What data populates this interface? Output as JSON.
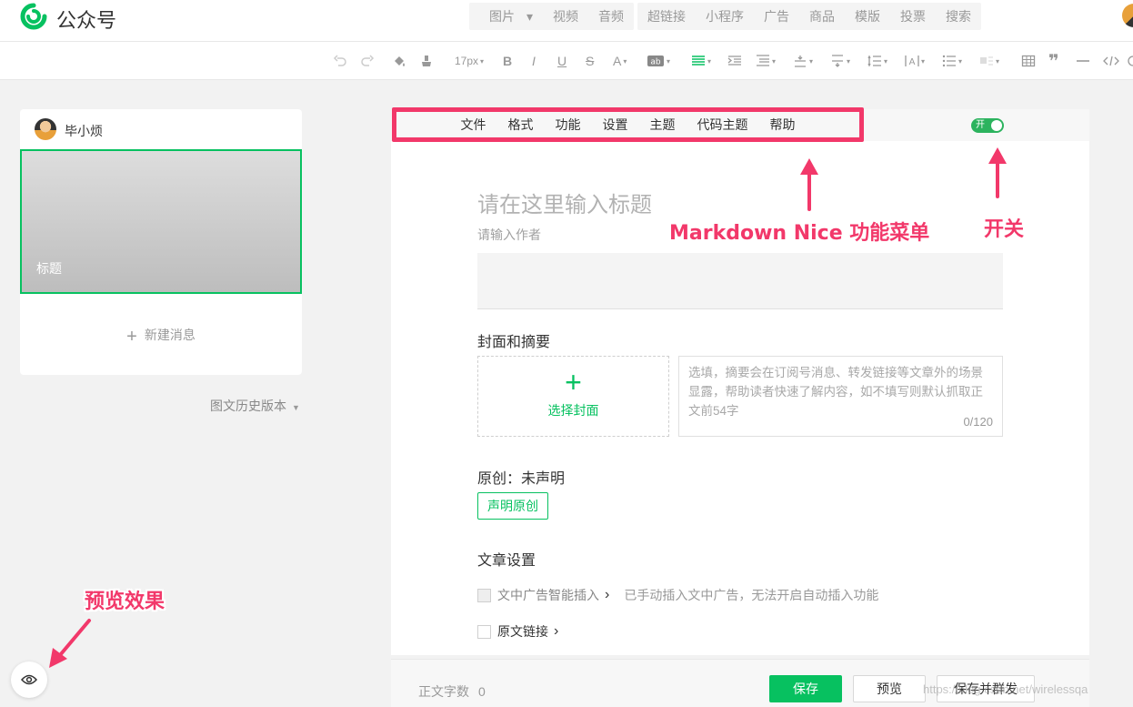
{
  "app": {
    "name": "公众号"
  },
  "topbar": {
    "insert_groups": [
      [
        "图片",
        "视频",
        "音频"
      ],
      [
        "超链接",
        "小程序",
        "广告",
        "商品",
        "模版",
        "投票",
        "搜索"
      ]
    ],
    "image_caret": "▾"
  },
  "toolbar": {
    "font_size": "17px"
  },
  "left": {
    "account_name": "毕小烦",
    "article_title": "标题",
    "new_message": "新建消息",
    "history": "图文历史版本"
  },
  "nice_menu": [
    "文件",
    "格式",
    "功能",
    "设置",
    "主题",
    "代码主题",
    "帮助"
  ],
  "toggle_label": "开",
  "editor": {
    "title_placeholder": "请在这里输入标题",
    "author_placeholder": "请输入作者",
    "cover_section": "封面和摘要",
    "cover_button": "选择封面",
    "summary_placeholder": "选填，摘要会在订阅号消息、转发链接等文章外的场景显露，帮助读者快速了解内容，如不填写则默认抓取正文前54字",
    "summary_count": "0/120",
    "original_label": "原创：未声明",
    "original_button": "声明原创",
    "settings_section": "文章设置",
    "ad_insert_label": "文中广告智能插入",
    "ad_insert_note": "已手动插入文中广告，无法开启自动插入功能",
    "source_link_label": "原文链接",
    "chevron": "›"
  },
  "footer": {
    "word_count_label": "正文字数",
    "word_count": "0",
    "save": "保存",
    "preview": "预览",
    "save_publish": "保存并群发",
    "watermark": "https://blog.csdn.net/wirelessqa"
  },
  "annotations": {
    "menu": "Markdown Nice 功能菜单",
    "switch": "开关",
    "preview": "预览效果"
  },
  "colors": {
    "accent": "#07c160",
    "annotation": "#f2386a",
    "toggle": "#2cb35e"
  }
}
